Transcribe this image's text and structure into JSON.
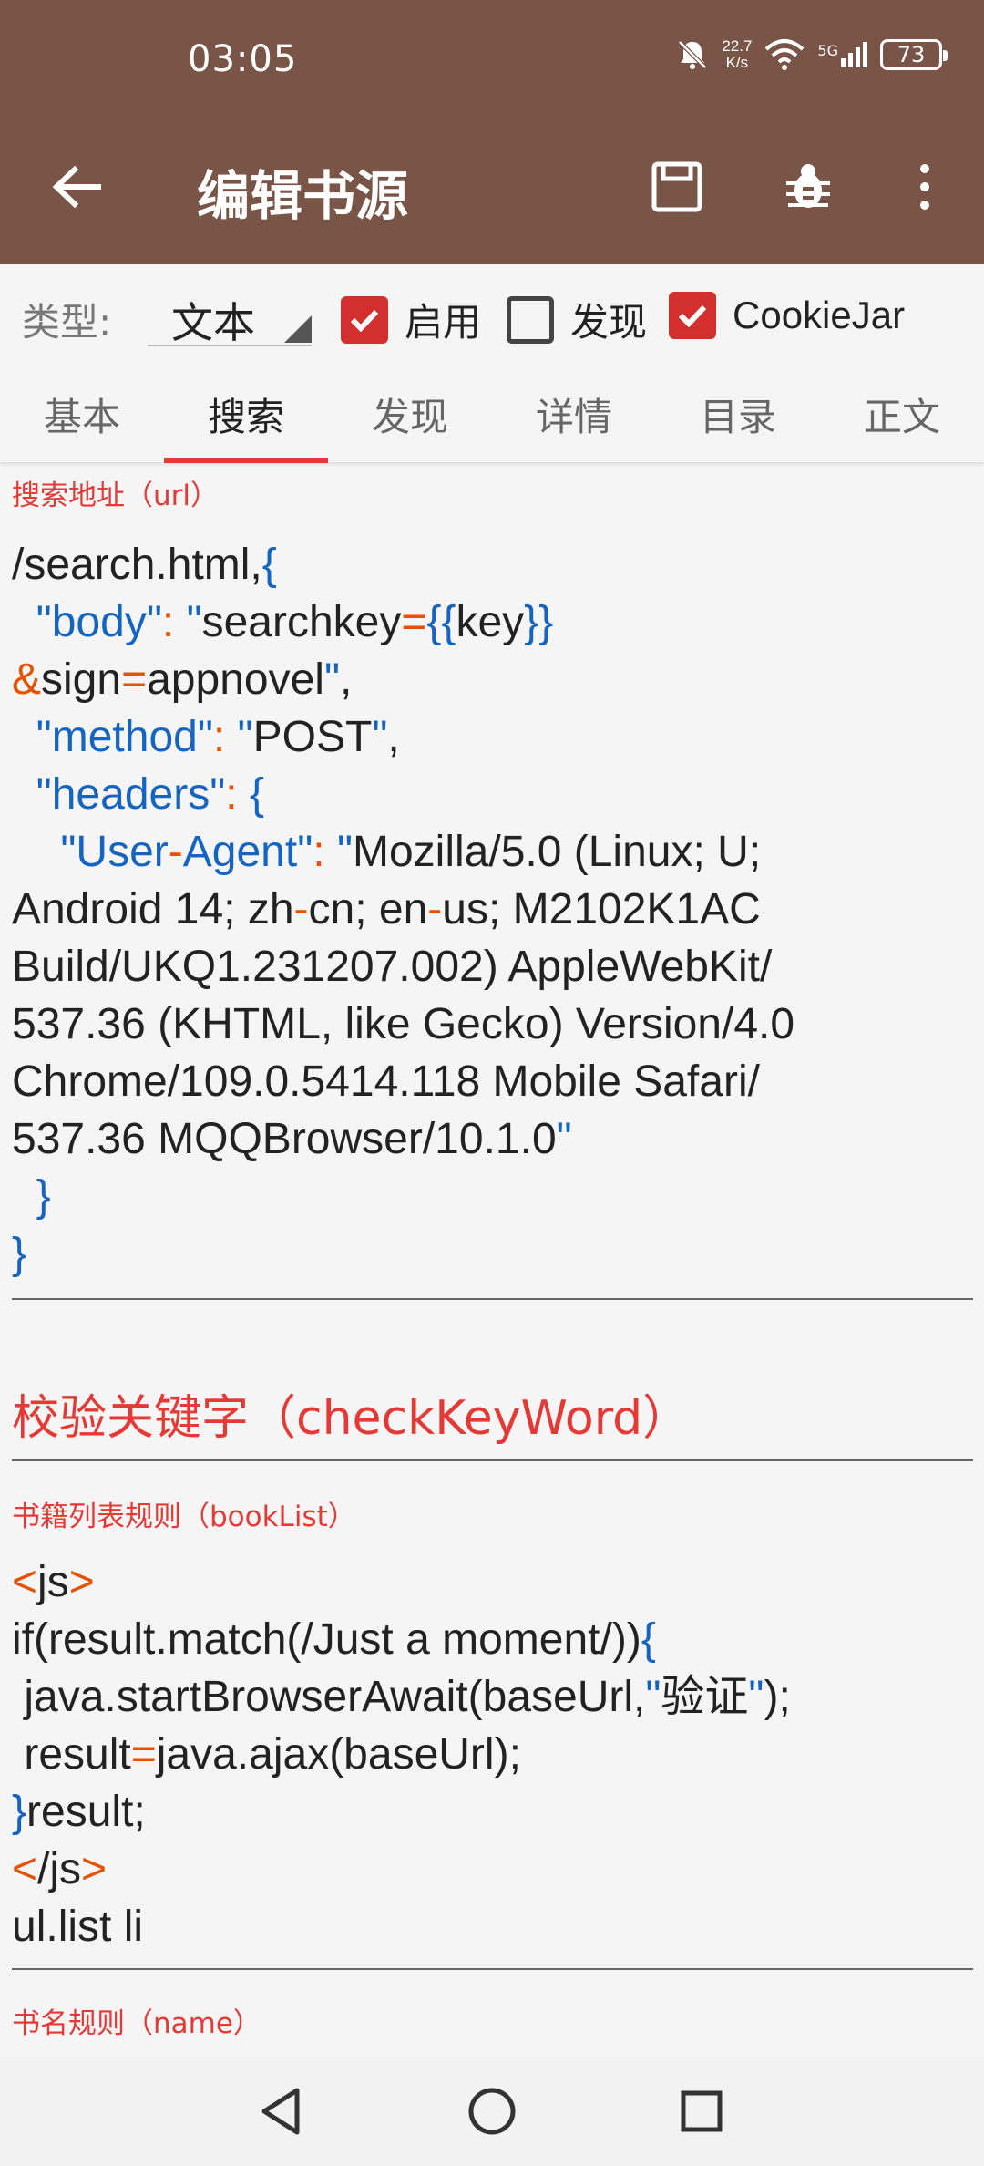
{
  "status": {
    "time": "03:05",
    "speed_value": "22.7",
    "speed_unit": "K/s",
    "network": "5G",
    "battery": "73"
  },
  "toolbar": {
    "title": "编辑书源"
  },
  "type_row": {
    "label": "类型:",
    "type_value": "文本",
    "checkboxes": [
      {
        "label": "启用",
        "checked": true
      },
      {
        "label": "发现",
        "checked": false
      },
      {
        "label": "CookieJar",
        "checked": true
      }
    ]
  },
  "tabs": [
    {
      "label": "基本",
      "active": false
    },
    {
      "label": "搜索",
      "active": true
    },
    {
      "label": "发现",
      "active": false
    },
    {
      "label": "详情",
      "active": false
    },
    {
      "label": "目录",
      "active": false
    },
    {
      "label": "正文",
      "active": false
    }
  ],
  "fields": {
    "search_url": {
      "label": "搜索地址（url）",
      "lines": [
        "/search.html,{",
        "  \"body\": \"searchkey={{key}}",
        "&sign=appnovel\",",
        "  \"method\": \"POST\",",
        "  \"headers\": {",
        "    \"User-Agent\": \"Mozilla/5.0 (Linux; U;",
        "Android 14; zh-cn; en-us; M2102K1AC",
        "Build/UKQ1.231207.002) AppleWebKit/",
        "537.36 (KHTML, like Gecko) Version/4.0",
        "Chrome/109.0.5414.118 Mobile Safari/",
        "537.36 MQQBrowser/10.1.0\"",
        "  }",
        "}"
      ]
    },
    "check_keyword": {
      "label": "校验关键字（checkKeyWord）"
    },
    "book_list": {
      "label": "书籍列表规则（bookList）",
      "lines": [
        "<js>",
        "if(result.match(/Just a moment/)){",
        " java.startBrowserAwait(baseUrl,\"验证\");",
        " result=java.ajax(baseUrl);",
        "}result;",
        "</js>",
        "ul.list li"
      ]
    },
    "name": {
      "label": "书名规则（name）"
    }
  },
  "colors": {
    "appbar": "#795548",
    "accent": "#e53935",
    "code_blue": "#1565c0",
    "code_orange": "#e65100"
  }
}
